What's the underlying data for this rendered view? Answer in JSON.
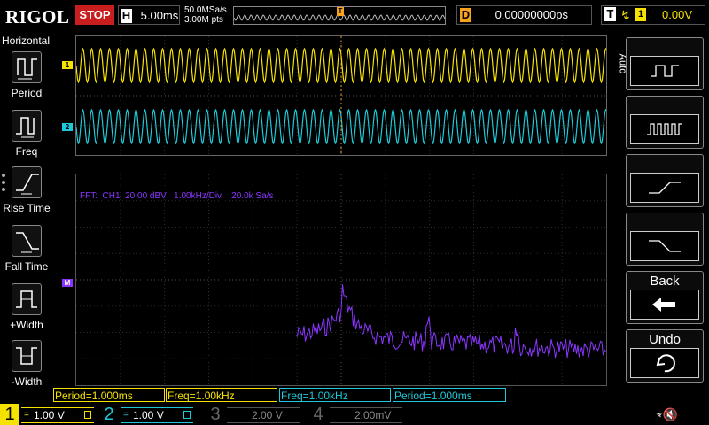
{
  "topbar": {
    "logo": "RIGOL",
    "run_state": "STOP",
    "timebase_key": "H",
    "timebase": "5.00ms",
    "sample_rate": "50.0MSa/s",
    "memory_depth": "3.00M pts",
    "trigger_track_marker": "T",
    "delay_key": "D",
    "delay": "0.00000000ps",
    "trigger_key": "T",
    "trigger_edge_icon": "rising-edge-icon",
    "trigger_source": "1",
    "trigger_level": "0.00V"
  },
  "left_menu": {
    "title": "Horizontal",
    "items": [
      {
        "label": "Period",
        "icon": "period-icon"
      },
      {
        "label": "Freq",
        "icon": "frequency-icon"
      },
      {
        "label": "Rise Time",
        "icon": "rise-time-icon"
      },
      {
        "label": "Fall Time",
        "icon": "fall-time-icon"
      },
      {
        "label": "+Width",
        "icon": "positive-width-icon"
      },
      {
        "label": "-Width",
        "icon": "negative-width-icon"
      }
    ]
  },
  "waveforms": {
    "ch1_marker": "1",
    "ch2_marker": "2",
    "trigger_marker": "T",
    "ch1_color": "#f6e200",
    "ch2_color": "#1ec8d8"
  },
  "fft": {
    "label": "FFT:  CH1  20.00 dBV   1.00kHz/Div    20.0k Sa/s",
    "marker": "M",
    "color": "#8a36ff"
  },
  "right_menu": {
    "side_label": "Auto",
    "buttons": [
      {
        "icon": "square-wave-icon",
        "label": ""
      },
      {
        "icon": "pulse-train-icon",
        "label": ""
      },
      {
        "icon": "rising-edge-icon",
        "label": ""
      },
      {
        "icon": "falling-edge-icon",
        "label": ""
      },
      {
        "icon": "back-arrow-icon",
        "label": "Back"
      },
      {
        "icon": "undo-icon",
        "label": "Undo"
      }
    ]
  },
  "measurements": [
    {
      "text": "Period=1.000ms",
      "color": "#f6e200"
    },
    {
      "text": "Freq=1.00kHz",
      "color": "#f6e200"
    },
    {
      "text": "Freq=1.00kHz",
      "color": "#1ec8d8"
    },
    {
      "text": "Period=1.000ms",
      "color": "#1ec8d8"
    }
  ],
  "channels": [
    {
      "num": "1",
      "volts": "1.00 V",
      "coupling": "DC",
      "color": "#f6e200",
      "active": true
    },
    {
      "num": "2",
      "volts": "1.00 V",
      "coupling": "DC",
      "color": "#1ec8d8",
      "active": true
    },
    {
      "num": "3",
      "volts": "2.00 V",
      "coupling": "DC",
      "color": "#666666",
      "active": false
    },
    {
      "num": "4",
      "volts": "2.00mV",
      "coupling": "DC",
      "color": "#666666",
      "active": false
    }
  ]
}
